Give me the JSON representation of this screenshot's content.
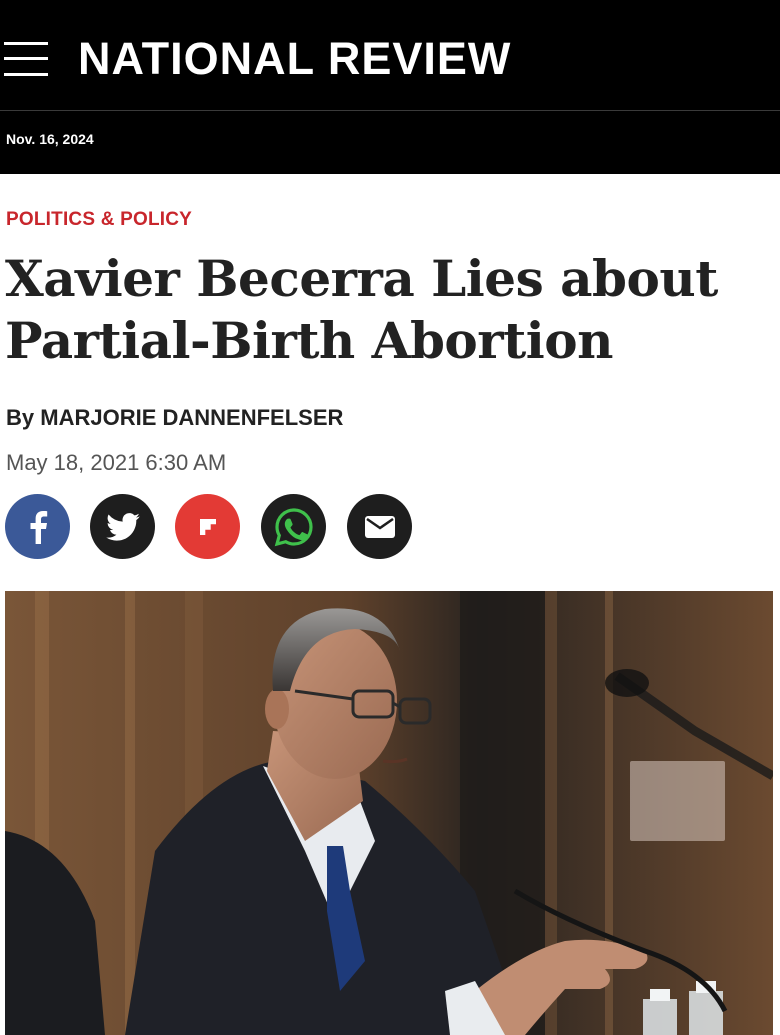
{
  "header": {
    "logo_text": "NATIONAL REVIEW",
    "date": "Nov. 16, 2024"
  },
  "article": {
    "category": "POLITICS & POLICY",
    "title_line1": "Xavier Becerra Lies about",
    "title_line2": "Partial-Birth Abortion",
    "byline_prefix": "By",
    "author": "MARJORIE DANNENFELSER",
    "published": "May 18, 2021 6:30 AM"
  },
  "share": [
    {
      "icon": "facebook-icon",
      "color": "#3b5998"
    },
    {
      "icon": "twitter-icon",
      "color": "#1e1e1e"
    },
    {
      "icon": "flipboard-icon",
      "color": "#e33a35"
    },
    {
      "icon": "whatsapp-icon",
      "color": "#1e1e1e"
    },
    {
      "icon": "email-icon",
      "color": "#1e1e1e"
    }
  ],
  "colors": {
    "brand_black": "#000000",
    "category_red": "#c8262c",
    "headline": "#222222"
  }
}
